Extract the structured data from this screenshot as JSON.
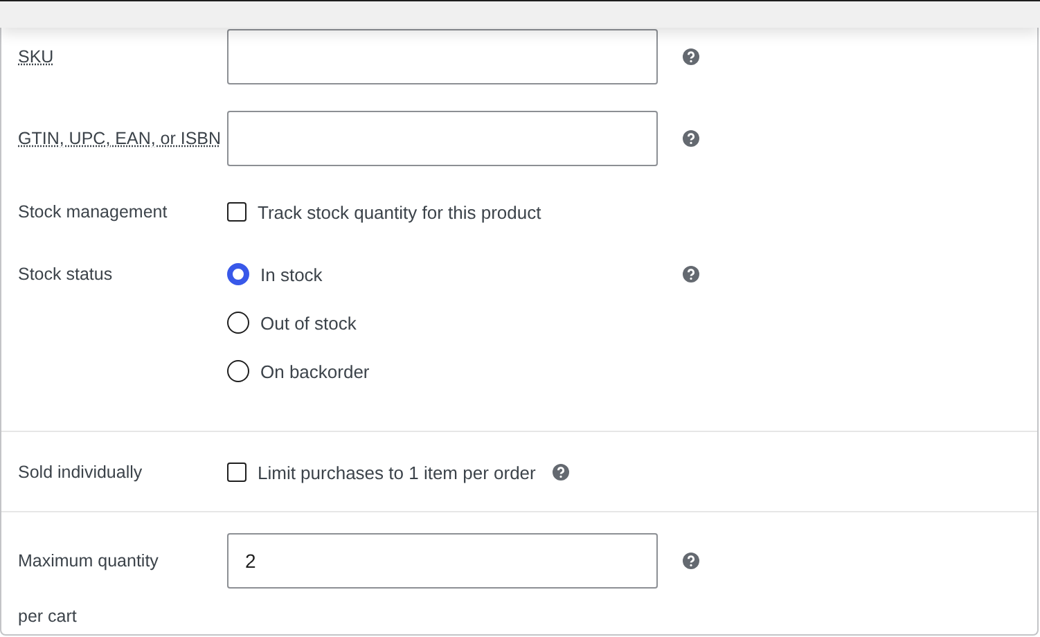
{
  "sections": [
    {
      "rows": [
        {
          "kind": "text",
          "label": "SKU",
          "label_abbr": true,
          "help": true
        },
        {
          "kind": "text",
          "label": "GTIN, UPC, EAN, or ISBN",
          "label_abbr": true,
          "help": true
        },
        {
          "kind": "checkbox",
          "label": "Stock management",
          "option": "Track stock quantity for this product",
          "checked": false
        },
        {
          "kind": "radio",
          "label": "Stock status",
          "help": true,
          "options": [
            {
              "label": "In stock",
              "selected": true
            },
            {
              "label": "Out of stock",
              "selected": false
            },
            {
              "label": "On backorder",
              "selected": false
            }
          ]
        }
      ]
    },
    {
      "rows": [
        {
          "kind": "checkbox",
          "label": "Sold individually",
          "option": "Limit purchases to 1 item per order",
          "checked": false,
          "help": true
        }
      ]
    },
    {
      "rows": [
        {
          "kind": "text",
          "label": "Maximum quantity per cart",
          "value": "2",
          "help": true,
          "label_wrap": true
        }
      ]
    }
  ]
}
